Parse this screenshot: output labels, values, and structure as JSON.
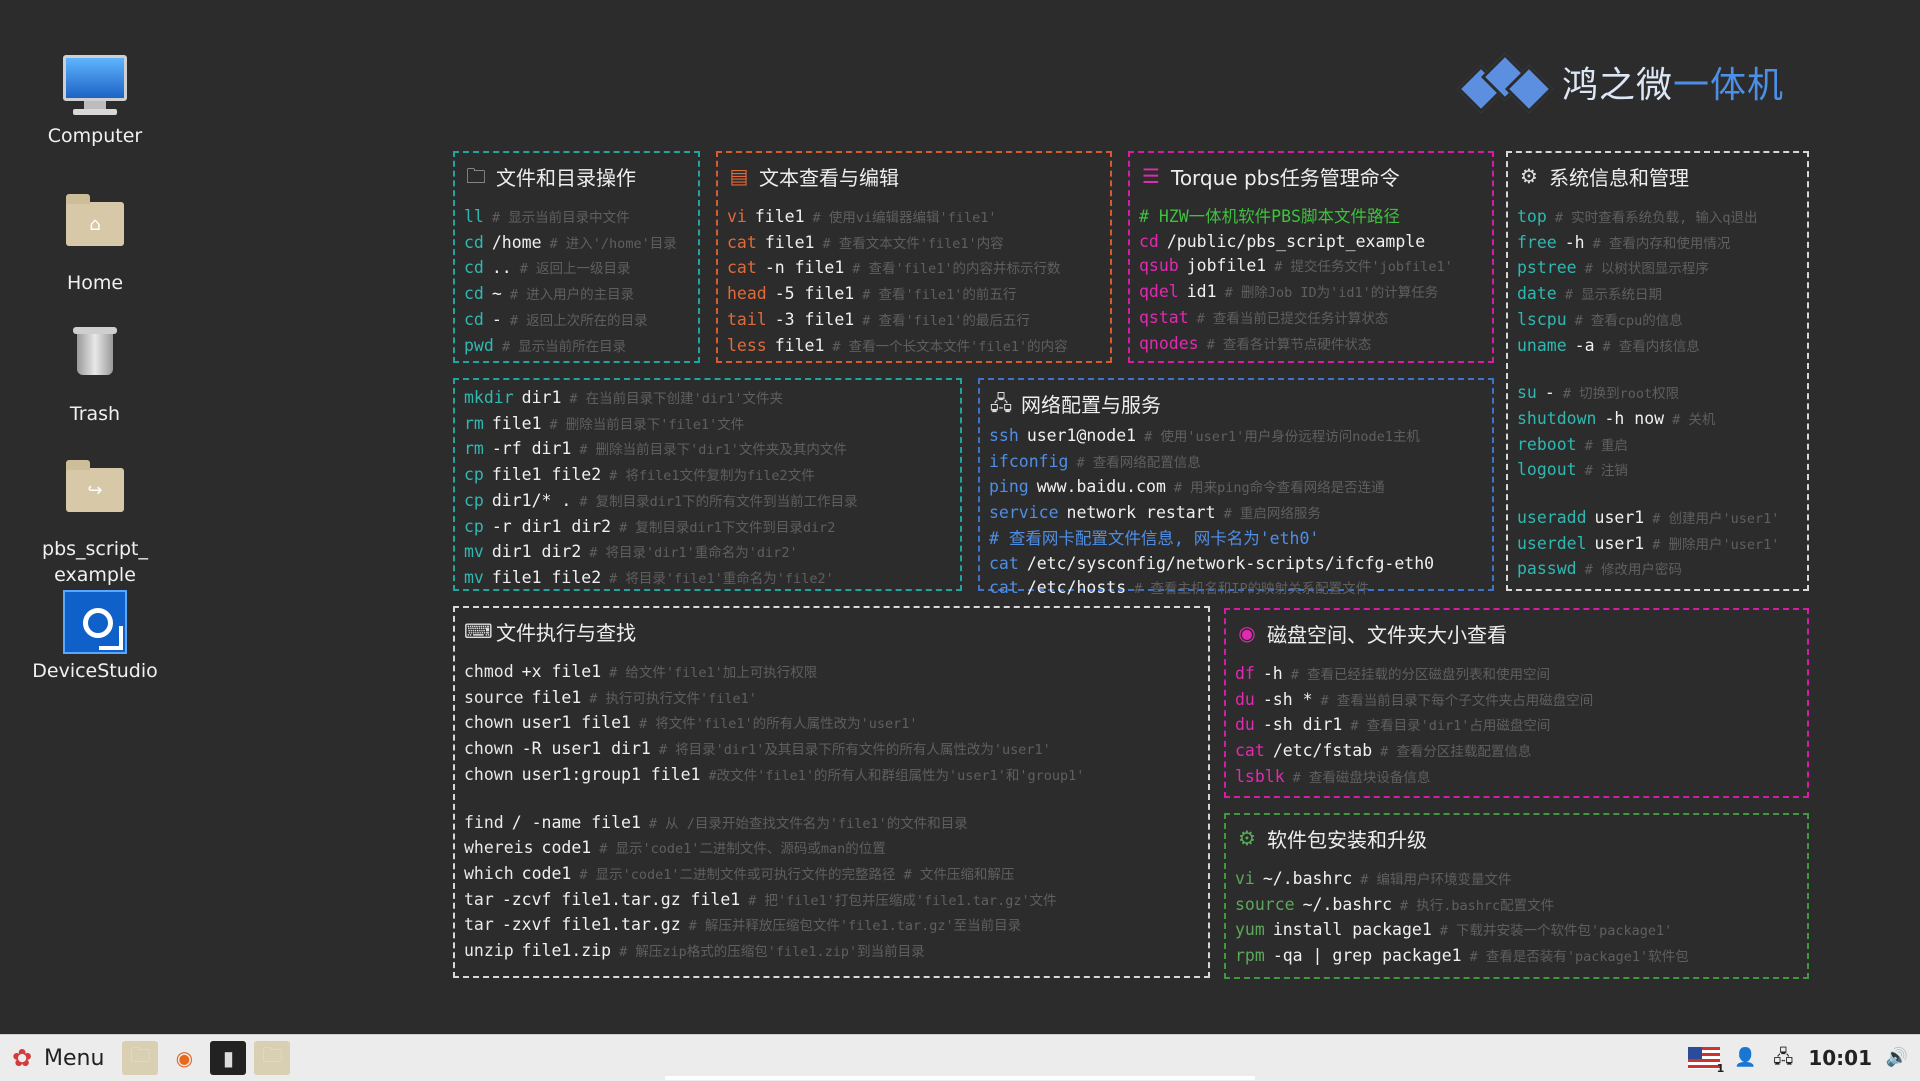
{
  "desktop": {
    "icons": [
      {
        "label": "Computer",
        "icon": "computer-icon"
      },
      {
        "label": "Home",
        "icon": "home-folder-icon"
      },
      {
        "label": "Trash",
        "icon": "trash-icon"
      },
      {
        "label": "pbs_script_\nexample",
        "icon": "folder-icon"
      },
      {
        "label": "DeviceStudio",
        "icon": "devicestudio-icon"
      }
    ]
  },
  "logo": {
    "part1": "鸿之微",
    "part2": "一体机"
  },
  "panels": {
    "files": {
      "title": "文件和目录操作",
      "lines": [
        {
          "cmd": "ll",
          "args": "",
          "comment": "# 显示当前目录中文件"
        },
        {
          "cmd": "cd",
          "args": "/home",
          "comment": "# 进入'/home'目录"
        },
        {
          "cmd": "cd",
          "args": "..",
          "comment": "# 返回上一级目录"
        },
        {
          "cmd": "cd",
          "args": "~",
          "comment": "# 进入用户的主目录"
        },
        {
          "cmd": "cd",
          "args": "-",
          "comment": "# 返回上次所在的目录"
        },
        {
          "cmd": "pwd",
          "args": "",
          "comment": "# 显示当前所在目录"
        }
      ]
    },
    "text": {
      "title": "文本查看与编辑",
      "lines": [
        {
          "cmd": "vi",
          "args": "file1",
          "comment": "# 使用vi编辑器编辑'file1'"
        },
        {
          "cmd": "cat",
          "args": "file1",
          "comment": "# 查看文本文件'file1'内容"
        },
        {
          "cmd": "cat",
          "args": "-n file1",
          "comment": "# 查看'file1'的内容并标示行数"
        },
        {
          "cmd": "head",
          "args": "-5 file1",
          "comment": "# 查看'file1'的前五行"
        },
        {
          "cmd": "tail",
          "args": "-3 file1",
          "comment": "# 查看'file1'的最后五行"
        },
        {
          "cmd": "less",
          "args": "file1",
          "comment": "# 查看一个长文本文件'file1'的内容"
        }
      ]
    },
    "torque": {
      "title": "Torque pbs任务管理命令",
      "lines": [
        {
          "cmd": "",
          "args": "",
          "comment": "# HZW一体机软件PBS脚本文件路径",
          "bright": true
        },
        {
          "cmd": "cd",
          "args": "/public/pbs_script_example",
          "comment": ""
        },
        {
          "cmd": "qsub",
          "args": "jobfile1",
          "comment": "# 提交任务文件'jobfile1'"
        },
        {
          "cmd": "qdel",
          "args": "id1",
          "comment": "# 删除Job ID为'id1'的计算任务"
        },
        {
          "cmd": "qstat",
          "args": "",
          "comment": "# 查看当前已提交任务计算状态"
        },
        {
          "cmd": "qnodes",
          "args": "",
          "comment": "# 查看各计算节点硬件状态"
        }
      ]
    },
    "sysinfo": {
      "title": "系统信息和管理",
      "groups": [
        [
          {
            "cmd": "top",
            "args": "",
            "comment": "# 实时查看系统负载, 输入q退出"
          },
          {
            "cmd": "free",
            "args": "-h",
            "comment": "# 查看内存和使用情况"
          },
          {
            "cmd": "pstree",
            "args": "",
            "comment": "# 以树状图显示程序"
          },
          {
            "cmd": "date",
            "args": "",
            "comment": "# 显示系统日期"
          },
          {
            "cmd": "lscpu",
            "args": "",
            "comment": "# 查看cpu的信息"
          },
          {
            "cmd": "uname",
            "args": "-a",
            "comment": "# 查看内核信息"
          }
        ],
        [
          {
            "cmd": "su",
            "args": "-",
            "comment": "# 切换到root权限"
          },
          {
            "cmd": "shutdown",
            "args": "-h now",
            "comment": "# 关机"
          },
          {
            "cmd": "reboot",
            "args": "",
            "comment": "# 重启"
          },
          {
            "cmd": "logout",
            "args": "",
            "comment": "# 注销"
          }
        ],
        [
          {
            "cmd": "useradd",
            "args": "user1",
            "comment": "# 创建用户'user1'"
          },
          {
            "cmd": "userdel",
            "args": "user1",
            "comment": "# 删除用户'user1'"
          },
          {
            "cmd": "passwd",
            "args": "",
            "comment": "# 修改用户密码"
          }
        ]
      ]
    },
    "fileops": {
      "title": "",
      "lines": [
        {
          "cmd": "mkdir",
          "args": "dir1",
          "comment": "# 在当前目录下创建'dir1'文件夹"
        },
        {
          "cmd": "rm",
          "args": "file1",
          "comment": "# 删除当前目录下'file1'文件"
        },
        {
          "cmd": "rm",
          "args": "-rf dir1",
          "comment": "# 删除当前目录下'dir1'文件夹及其内文件"
        },
        {
          "cmd": "cp",
          "args": "file1 file2",
          "comment": "# 将file1文件复制为file2文件"
        },
        {
          "cmd": "cp",
          "args": "dir1/* .",
          "comment": "# 复制目录dir1下的所有文件到当前工作目录"
        },
        {
          "cmd": "cp",
          "args": "-r dir1 dir2",
          "comment": "# 复制目录dir1下文件到目录dir2"
        },
        {
          "cmd": "mv",
          "args": "dir1 dir2",
          "comment": "# 将目录'dir1'重命名为'dir2'"
        },
        {
          "cmd": "mv",
          "args": "file1 file2",
          "comment": "# 将目录'file1'重命名为'file2'"
        }
      ]
    },
    "network": {
      "title": "网络配置与服务",
      "lines": [
        {
          "cmd": "ssh",
          "args": "user1@node1",
          "comment": "# 使用'user1'用户身份远程访问node1主机"
        },
        {
          "cmd": "ifconfig",
          "args": "",
          "comment": "# 查看网络配置信息"
        },
        {
          "cmd": "ping",
          "args": "www.baidu.com",
          "comment": "# 用来ping命令查看网络是否连通"
        },
        {
          "cmd": "service",
          "args": "network restart",
          "comment": "# 重启网络服务"
        },
        {
          "cmd": "",
          "args": "",
          "comment": "# 查看网卡配置文件信息, 网卡名为'eth0'",
          "bright": true,
          "blue": true
        },
        {
          "cmd": "cat",
          "args": "/etc/sysconfig/network-scripts/ifcfg-eth0",
          "comment": ""
        },
        {
          "cmd": "cat",
          "args": "/etc/hosts",
          "comment": "# 查看主机名和IP的映射关系配置文件"
        }
      ]
    },
    "exec": {
      "title": "文件执行与查找",
      "groups": [
        [
          {
            "cmd": "chmod",
            "args": "+x file1",
            "comment": "# 给文件'file1'加上可执行权限"
          },
          {
            "cmd": "source",
            "args": "file1",
            "comment": "# 执行可执行文件'file1'"
          },
          {
            "cmd": "chown",
            "args": "user1 file1",
            "comment": "# 将文件'file1'的所有人属性改为'user1'"
          },
          {
            "cmd": "chown",
            "args": "-R user1 dir1",
            "comment": "# 将目录'dir1'及其目录下所有文件的所有人属性改为'user1'"
          },
          {
            "cmd": "chown",
            "args": "user1:group1 file1",
            "comment": "#改文件'file1'的所有人和群组属性为'user1'和'group1'"
          }
        ],
        [
          {
            "cmd": "find",
            "args": "/ -name file1",
            "comment": "# 从 /目录开始查找文件名为'file1'的文件和目录"
          },
          {
            "cmd": "whereis",
            "args": "code1",
            "comment": "# 显示'code1'二进制文件、源码或man的位置"
          },
          {
            "cmd": "which",
            "args": "code1",
            "comment": "# 显示'code1'二进制文件或可执行文件的完整路径 # 文件压缩和解压"
          },
          {
            "cmd": "tar",
            "args": "-zcvf file1.tar.gz  file1",
            "comment": "# 把'file1'打包并压缩成'file1.tar.gz'文件"
          },
          {
            "cmd": "tar",
            "args": "-zxvf file1.tar.gz",
            "comment": "# 解压并释放压缩包文件'file1.tar.gz'至当前目录"
          },
          {
            "cmd": "unzip",
            "args": "file1.zip",
            "comment": "# 解压zip格式的压缩包'file1.zip'到当前目录"
          }
        ]
      ]
    },
    "disk": {
      "title": "磁盘空间、文件夹大小查看",
      "lines": [
        {
          "cmd": "df",
          "args": "-h",
          "comment": "# 查看已经挂载的分区磁盘列表和使用空间"
        },
        {
          "cmd": "du",
          "args": "-sh *",
          "comment": "# 查看当前目录下每个子文件夹占用磁盘空间"
        },
        {
          "cmd": "du",
          "args": "-sh dir1",
          "comment": "# 查看目录'dir1'占用磁盘空间"
        },
        {
          "cmd": "cat",
          "args": "/etc/fstab",
          "comment": "# 查看分区挂载配置信息"
        },
        {
          "cmd": "lsblk",
          "args": "",
          "comment": "# 查看磁盘块设备信息"
        }
      ]
    },
    "software": {
      "title": "软件包安装和升级",
      "lines": [
        {
          "cmd": "vi",
          "args": "~/.bashrc",
          "comment": "# 编辑用户环境变量文件"
        },
        {
          "cmd": "source",
          "args": "~/.bashrc",
          "comment": "# 执行.bashrc配置文件"
        },
        {
          "cmd": "yum",
          "args": "install package1",
          "comment": "# 下载并安装一个软件包'package1'"
        },
        {
          "cmd": "rpm",
          "args": "-qa | grep package1",
          "comment": "# 查看是否装有'package1'软件包"
        }
      ]
    }
  },
  "taskbar": {
    "menu_label": "Menu",
    "clock": "10:01",
    "keyboard": "1"
  },
  "colors": {
    "teal": "#1fa5a0",
    "orange": "#d85a2e",
    "magenta": "#d41ca6",
    "blue": "#3f73c8",
    "green": "#3f9a3f",
    "background": "#2c2c2c"
  }
}
